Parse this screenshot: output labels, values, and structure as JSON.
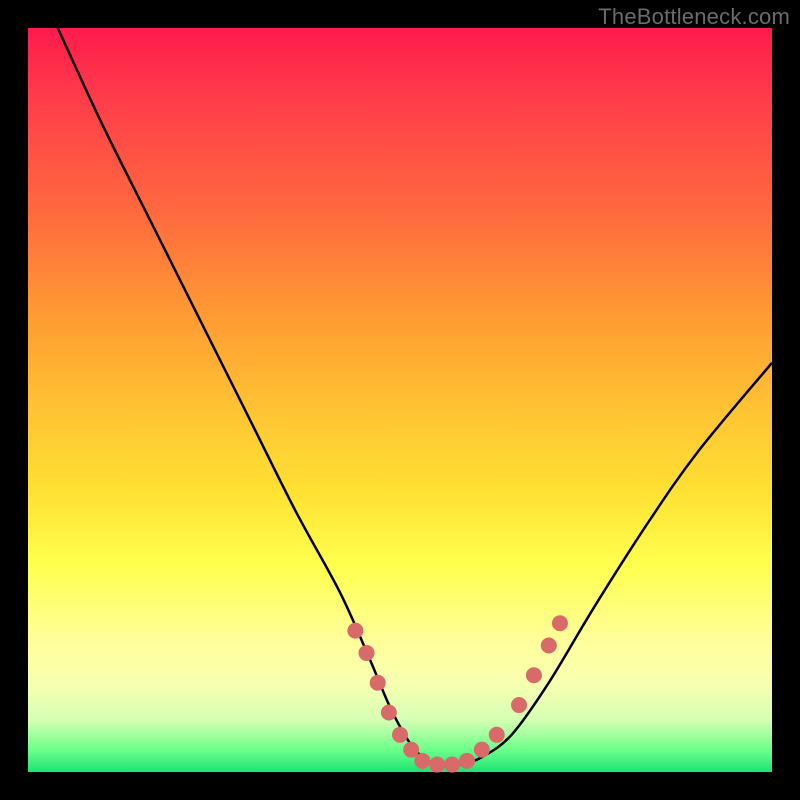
{
  "watermark": "TheBottleneck.com",
  "colors": {
    "frame": "#000000",
    "curve": "#000000",
    "dots": "#d96a6a",
    "gradient_stops": [
      "#ff1a4d",
      "#ff3e4a",
      "#ff6a3e",
      "#ff9933",
      "#ffbf33",
      "#ffe033",
      "#ffff4d",
      "#ffff99",
      "#f8ffb0",
      "#d6ffb3",
      "#6dff8a",
      "#1fe276"
    ]
  },
  "chart_data": {
    "type": "line",
    "title": "",
    "xlabel": "",
    "ylabel": "",
    "xlim": [
      0,
      100
    ],
    "ylim": [
      0,
      100
    ],
    "note": "Axes are normalized 0–100; no tick labels are shown in the source image so values are estimated from pixel positions.",
    "series": [
      {
        "name": "curve",
        "x": [
          4,
          10,
          17,
          24,
          30,
          36,
          42,
          46,
          49,
          52,
          55,
          58,
          61,
          65,
          70,
          76,
          83,
          90,
          100
        ],
        "y": [
          100,
          87,
          73,
          59,
          47,
          35,
          24,
          15,
          8,
          3,
          1,
          1,
          2,
          5,
          12,
          22,
          33,
          43,
          55
        ]
      }
    ],
    "dots": {
      "name": "highlight-dots",
      "points": [
        {
          "x": 44,
          "y": 19
        },
        {
          "x": 45.5,
          "y": 16
        },
        {
          "x": 47,
          "y": 12
        },
        {
          "x": 48.5,
          "y": 8
        },
        {
          "x": 50,
          "y": 5
        },
        {
          "x": 51.5,
          "y": 3
        },
        {
          "x": 53,
          "y": 1.5
        },
        {
          "x": 55,
          "y": 1
        },
        {
          "x": 57,
          "y": 1
        },
        {
          "x": 59,
          "y": 1.5
        },
        {
          "x": 61,
          "y": 3
        },
        {
          "x": 63,
          "y": 5
        },
        {
          "x": 66,
          "y": 9
        },
        {
          "x": 68,
          "y": 13
        },
        {
          "x": 70,
          "y": 17
        },
        {
          "x": 71.5,
          "y": 20
        }
      ]
    }
  }
}
